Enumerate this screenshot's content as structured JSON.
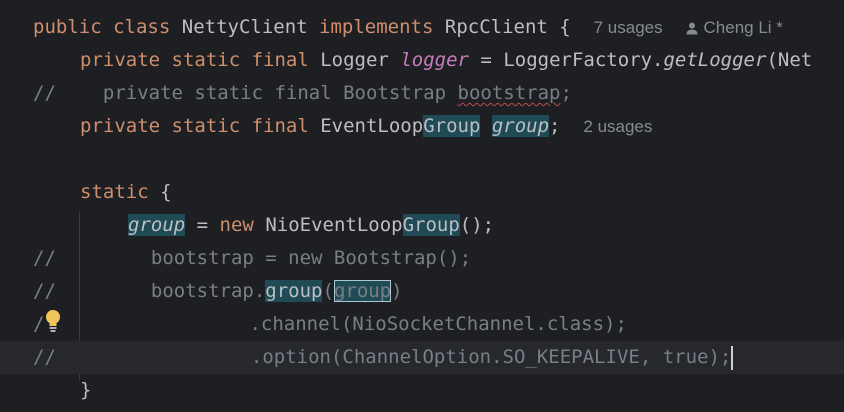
{
  "code": {
    "l1": {
      "kw_public": "public",
      "kw_class": "class",
      "name": "NettyClient",
      "kw_implements": "implements",
      "iface": "RpcClient {",
      "usages_hint": "7 usages",
      "author_hint": "Cheng Li *"
    },
    "l2": {
      "kw": "private static final",
      "type": "Logger",
      "field": "logger",
      "eq": "=",
      "factory": "LoggerFactory.",
      "method": "getLogger",
      "rest": "(Net"
    },
    "l3": {
      "slashes": "//",
      "text_before": "private static final Bootstrap ",
      "squiggle": "bootstrap",
      "semi": ";"
    },
    "l4": {
      "kw": "private static final",
      "type_a": "EventLoop",
      "type_b": "Group",
      "field": "group",
      "semi": ";",
      "usages_hint": "2 usages"
    },
    "l6": {
      "kw": "static",
      "brace": "{"
    },
    "l7": {
      "field": "group",
      "eq": " = ",
      "kw_new": "new",
      "type_a": "NioEventLoop",
      "type_b": "Group",
      "rest": "();"
    },
    "l8": {
      "slashes": "//",
      "text": "bootstrap = new Bootstrap();"
    },
    "l9": {
      "slashes": "//",
      "text": "bootstrap.",
      "hl1": "group",
      "paren": "(",
      "hl2": "group",
      "close": ")"
    },
    "l10": {
      "slashes": "/",
      "text": ".channel(NioSocketChannel.class);"
    },
    "l11": {
      "slashes": "//",
      "text": ".option(ChannelOption.SO_KEEPALIVE, true);"
    },
    "l12": {
      "brace": "}"
    }
  },
  "icons": {
    "author": "user-icon",
    "intention": "lightbulb-icon"
  },
  "colors": {
    "background": "#1e1f22",
    "keyword": "#cf8e6d",
    "field": "#c77dbb",
    "comment": "#7a7e85",
    "highlight": "#1f4b57"
  }
}
